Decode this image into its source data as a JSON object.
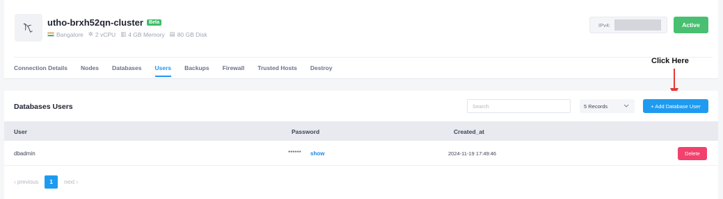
{
  "cluster": {
    "name": "utho-brxh52qn-cluster",
    "badge": "Beta",
    "location": "Bangalore",
    "cpu": "2 vCPU",
    "memory": "4 GB Memory",
    "disk": "80 GB Disk",
    "ipv4_label": "IPv4:",
    "status": "Active"
  },
  "tabs": [
    {
      "label": "Connection Details",
      "active": false
    },
    {
      "label": "Nodes",
      "active": false
    },
    {
      "label": "Databases",
      "active": false
    },
    {
      "label": "Users",
      "active": true
    },
    {
      "label": "Backups",
      "active": false
    },
    {
      "label": "Firewall",
      "active": false
    },
    {
      "label": "Trusted Hosts",
      "active": false
    },
    {
      "label": "Destroy",
      "active": false
    }
  ],
  "annotation": {
    "text": "Click Here",
    "color": "#e53935"
  },
  "users_section": {
    "title": "Databases Users",
    "search_placeholder": "Search",
    "records_select": "5 Records",
    "add_button": "+ Add Database User",
    "columns": [
      "User",
      "Password",
      "Created_at"
    ],
    "rows": [
      {
        "user": "dbadmin",
        "password_mask": "******",
        "show_label": "show",
        "created_at": "2024-11-19 17:49:46",
        "action": "Delete"
      }
    ],
    "pagination": {
      "previous": "‹ previous",
      "current_page": "1",
      "next": "next ›"
    }
  },
  "colors": {
    "accent": "#2196f3",
    "active_status": "#49c071",
    "delete": "#f1416c",
    "beta": "#3fbd6a"
  }
}
